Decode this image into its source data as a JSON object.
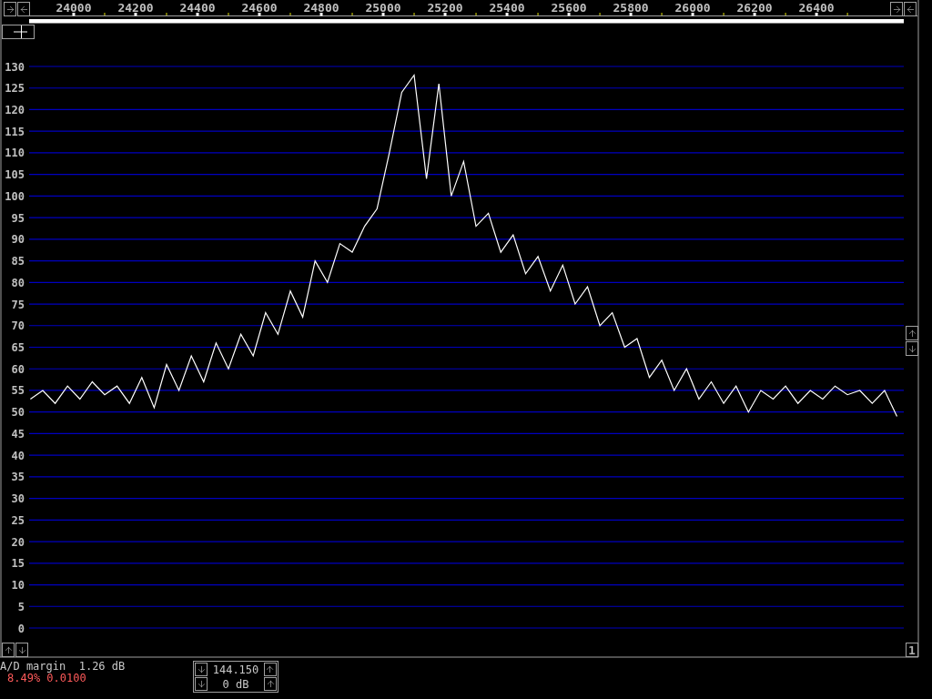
{
  "spectrum": {
    "chart_data": {
      "type": "line",
      "grid": true,
      "xlim": [
        23856,
        26682
      ],
      "ylim": [
        0,
        130
      ],
      "xticks": [
        24000,
        24200,
        24400,
        24600,
        24800,
        25000,
        25200,
        25400,
        25600,
        25800,
        26000,
        26200,
        26400
      ],
      "yticks": [
        0,
        5,
        10,
        15,
        20,
        25,
        30,
        35,
        40,
        45,
        50,
        55,
        60,
        65,
        70,
        75,
        80,
        85,
        90,
        95,
        100,
        105,
        110,
        115,
        120,
        125,
        130
      ],
      "x": [
        23860,
        23900,
        23940,
        23980,
        24020,
        24060,
        24100,
        24140,
        24180,
        24220,
        24260,
        24300,
        24340,
        24380,
        24420,
        24460,
        24500,
        24540,
        24580,
        24620,
        24660,
        24700,
        24740,
        24780,
        24820,
        24860,
        24900,
        24940,
        24980,
        25020,
        25060,
        25100,
        25140,
        25180,
        25220,
        25260,
        25300,
        25340,
        25380,
        25420,
        25460,
        25500,
        25540,
        25580,
        25620,
        25660,
        25700,
        25740,
        25780,
        25820,
        25860,
        25900,
        25940,
        25980,
        26020,
        26060,
        26100,
        26140,
        26180,
        26220,
        26260,
        26300,
        26340,
        26380,
        26420,
        26460,
        26500,
        26540,
        26580,
        26620,
        26660
      ],
      "series": [
        {
          "color": "#ffffff",
          "values": [
            53,
            55,
            52,
            56,
            53,
            57,
            54,
            56,
            52,
            58,
            51,
            61,
            55,
            63,
            57,
            66,
            60,
            68,
            63,
            73,
            68,
            78,
            72,
            85,
            80,
            89,
            87,
            93,
            97,
            110,
            124,
            128,
            104,
            126,
            100,
            108,
            93,
            96,
            87,
            91,
            82,
            86,
            78,
            84,
            75,
            79,
            70,
            73,
            65,
            67,
            58,
            62,
            55,
            60,
            53,
            57,
            52,
            56,
            50,
            55,
            53,
            56,
            52,
            55,
            53,
            56,
            54,
            55,
            52,
            55,
            49
          ]
        }
      ]
    }
  },
  "status": {
    "ad_margin": "A/D margin  1.26 dB",
    "overload": "8.49% 0.0100"
  },
  "frequency_box": {
    "frequency": "144.150",
    "gain": "0 dB"
  },
  "channel_box": {
    "label": "1"
  }
}
